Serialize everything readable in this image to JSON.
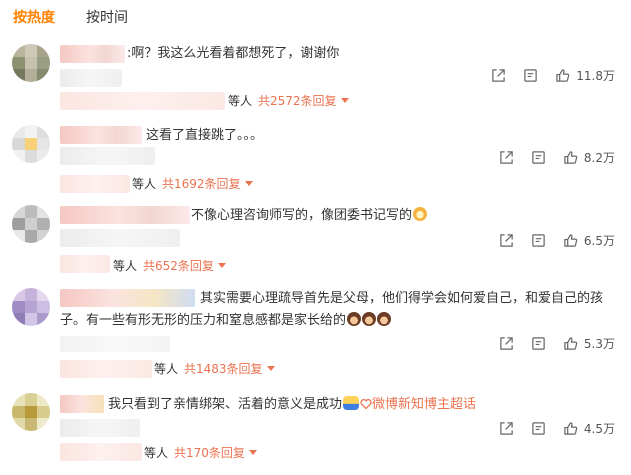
{
  "tabs": [
    {
      "label": "按热度",
      "active": true
    },
    {
      "label": "按时间",
      "active": false
    }
  ],
  "comments": [
    {
      "text": ":啊？我这么光看着都想死了，谢谢你",
      "likes": "11.8万",
      "replies_prefix": "等人",
      "replies_count": "共2572条回复"
    },
    {
      "text": "这看了直接跳了。。。",
      "likes": "8.2万",
      "replies_prefix": "等人",
      "replies_count": "共1692条回复"
    },
    {
      "text": "不像心理咨询师写的，像团委书记写的",
      "likes": "6.5万",
      "replies_prefix": "等人",
      "replies_count": "共652条回复"
    },
    {
      "text": "其实需要心理疏导首先是父母，他们得学会如何爱自己，和爱自己的孩子。有一些有形无形的压力和窒息感都是家长给的",
      "likes": "5.3万",
      "replies_prefix": "等人",
      "replies_count": "共1483条回复"
    },
    {
      "text": "我只看到了亲情绑架、活着的意义是成功",
      "supertopic": "微博新知博主超话",
      "likes": "4.5万",
      "replies_prefix": "等人",
      "replies_count": "共170条回复"
    }
  ],
  "icons": {
    "share": "share-icon",
    "comment": "comment-icon",
    "like": "like-icon"
  },
  "colors": {
    "accent": "#ff8200",
    "reply": "#eb7350"
  }
}
